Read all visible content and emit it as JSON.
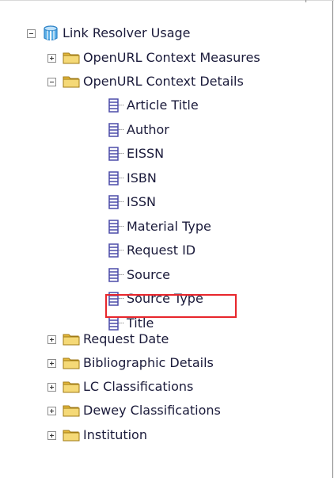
{
  "tree": {
    "root": {
      "label": "Link Resolver Usage",
      "icon": "cube-icon",
      "expanded": true
    },
    "folders": [
      {
        "label": "OpenURL Context Measures",
        "expanded": false
      },
      {
        "label": "OpenURL Context Details",
        "expanded": true,
        "children": [
          "Article Title",
          "Author",
          "EISSN",
          "ISBN",
          "ISSN",
          "Material Type",
          "Request ID",
          "Source",
          "Source Type",
          "Title"
        ]
      },
      {
        "label": "Request Date",
        "expanded": false
      },
      {
        "label": "Bibliographic Details",
        "expanded": false
      },
      {
        "label": "LC Classifications",
        "expanded": false
      },
      {
        "label": "Dewey Classifications",
        "expanded": false
      },
      {
        "label": "Institution",
        "expanded": false
      }
    ],
    "highlighted_item": "Source Type"
  },
  "colors": {
    "highlight_border": "#e8262c",
    "folder_fill": "#f2d36b",
    "attribute_icon": "#4b4ba8",
    "cube_icon": "#2e84c8"
  }
}
